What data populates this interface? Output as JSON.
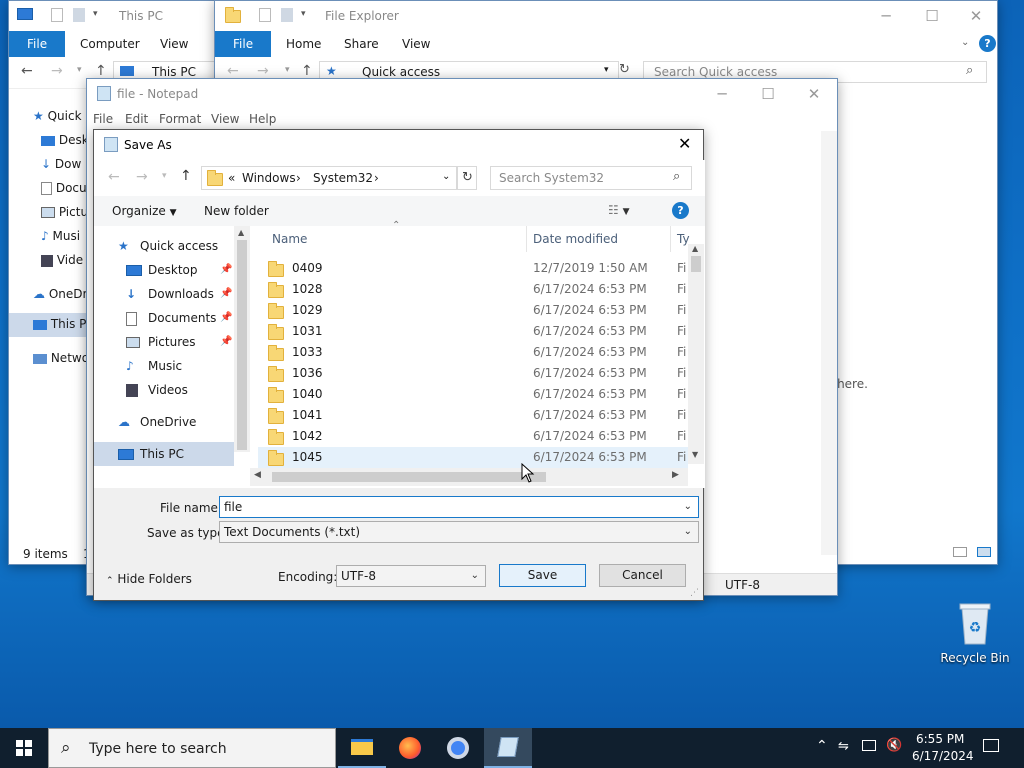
{
  "desktop": {
    "recycle_bin_label": "Recycle Bin"
  },
  "this_pc_window": {
    "title": "This PC",
    "tabs": [
      "File",
      "Computer",
      "View"
    ],
    "address": "This PC",
    "nav": [
      "Quick",
      "Desk",
      "Dow",
      "Docu",
      "Pictu",
      "Musi",
      "Vide",
      "OneDr",
      "This P",
      "Netwo"
    ],
    "status": "9 items",
    "status_extra": "1"
  },
  "explorer_window": {
    "title": "File Explorer",
    "tabs": [
      "File",
      "Home",
      "Share",
      "View"
    ],
    "address": "Quick access",
    "search_placeholder": "Search Quick access",
    "partial_text": "s here."
  },
  "notepad": {
    "title": "file - Notepad",
    "menu": [
      "File",
      "Edit",
      "Format",
      "View",
      "Help"
    ],
    "status_encoding": "UTF-8"
  },
  "save_dialog": {
    "title": "Save As",
    "breadcrumb_prefix": "«",
    "breadcrumb": [
      "Windows",
      "System32"
    ],
    "search_placeholder": "Search System32",
    "organize": "Organize",
    "new_folder": "New folder",
    "columns": {
      "name": "Name",
      "date": "Date modified",
      "type": "Ty"
    },
    "nav": [
      {
        "label": "Quick access",
        "icon": "star-icon",
        "pinned": false,
        "indent": 0
      },
      {
        "label": "Desktop",
        "icon": "desktop-icon",
        "pinned": true,
        "indent": 1
      },
      {
        "label": "Downloads",
        "icon": "download-icon",
        "pinned": true,
        "indent": 1
      },
      {
        "label": "Documents",
        "icon": "document-icon",
        "pinned": true,
        "indent": 1
      },
      {
        "label": "Pictures",
        "icon": "pictures-icon",
        "pinned": true,
        "indent": 1
      },
      {
        "label": "Music",
        "icon": "music-icon",
        "pinned": false,
        "indent": 1
      },
      {
        "label": "Videos",
        "icon": "video-icon",
        "pinned": false,
        "indent": 1
      },
      {
        "label": "OneDrive",
        "icon": "cloud-icon",
        "pinned": false,
        "indent": 0
      },
      {
        "label": "This PC",
        "icon": "computer-icon",
        "pinned": false,
        "indent": 0
      }
    ],
    "files": [
      {
        "name": "0409",
        "date": "12/7/2019 1:50 AM",
        "type": "Fi"
      },
      {
        "name": "1028",
        "date": "6/17/2024 6:53 PM",
        "type": "Fi"
      },
      {
        "name": "1029",
        "date": "6/17/2024 6:53 PM",
        "type": "Fi"
      },
      {
        "name": "1031",
        "date": "6/17/2024 6:53 PM",
        "type": "Fi"
      },
      {
        "name": "1033",
        "date": "6/17/2024 6:53 PM",
        "type": "Fi"
      },
      {
        "name": "1036",
        "date": "6/17/2024 6:53 PM",
        "type": "Fi"
      },
      {
        "name": "1040",
        "date": "6/17/2024 6:53 PM",
        "type": "Fi"
      },
      {
        "name": "1041",
        "date": "6/17/2024 6:53 PM",
        "type": "Fi"
      },
      {
        "name": "1042",
        "date": "6/17/2024 6:53 PM",
        "type": "Fi"
      },
      {
        "name": "1045",
        "date": "6/17/2024 6:53 PM",
        "type": "Fi"
      }
    ],
    "file_name_label": "File name:",
    "file_name_value": "file",
    "save_type_label": "Save as type:",
    "save_type_value": "Text Documents (*.txt)",
    "hide_folders": "Hide Folders",
    "encoding_label": "Encoding:",
    "encoding_value": "UTF-8",
    "save": "Save",
    "cancel": "Cancel"
  },
  "taskbar": {
    "search_placeholder": "Type here to search",
    "time": "6:55 PM",
    "date": "6/17/2024"
  },
  "colors": {
    "accent": "#1979ca",
    "taskbar": "#101f2e",
    "desktop": "#0e6fc6",
    "selection": "#ccd9ea"
  }
}
